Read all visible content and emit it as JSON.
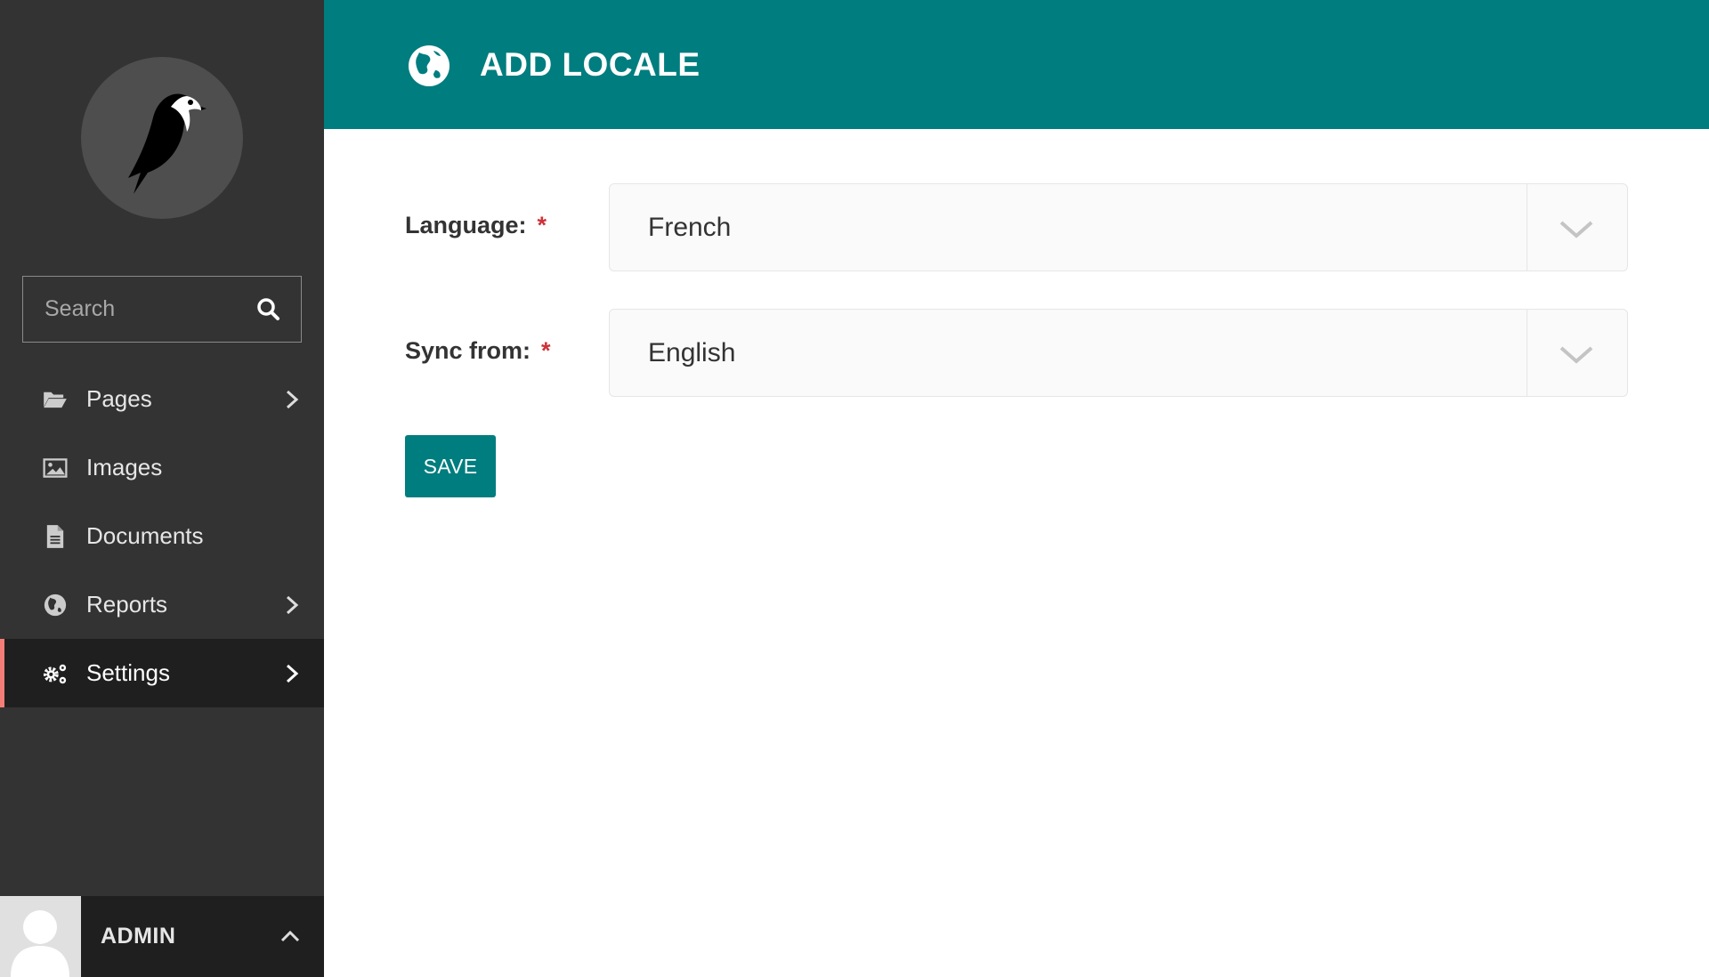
{
  "sidebar": {
    "search": {
      "placeholder": "Search"
    },
    "items": [
      {
        "label": "Pages",
        "icon": "folder-open-icon",
        "has_submenu": true
      },
      {
        "label": "Images",
        "icon": "image-icon",
        "has_submenu": false
      },
      {
        "label": "Documents",
        "icon": "document-icon",
        "has_submenu": false
      },
      {
        "label": "Reports",
        "icon": "globe-icon",
        "has_submenu": true
      },
      {
        "label": "Settings",
        "icon": "cogs-icon",
        "has_submenu": true,
        "active": true
      }
    ],
    "account": {
      "name": "ADMIN"
    }
  },
  "header": {
    "title": "ADD LOCALE",
    "icon": "globe-icon"
  },
  "form": {
    "language": {
      "label": "Language:",
      "required": "*",
      "value": "French"
    },
    "sync_from": {
      "label": "Sync from:",
      "required": "*",
      "value": "English"
    },
    "save_label": "SAVE"
  },
  "colors": {
    "sidebar_bg": "#333333",
    "header_bg": "#007d7e",
    "active_indicator": "#f37e77",
    "required": "#cd3238"
  }
}
